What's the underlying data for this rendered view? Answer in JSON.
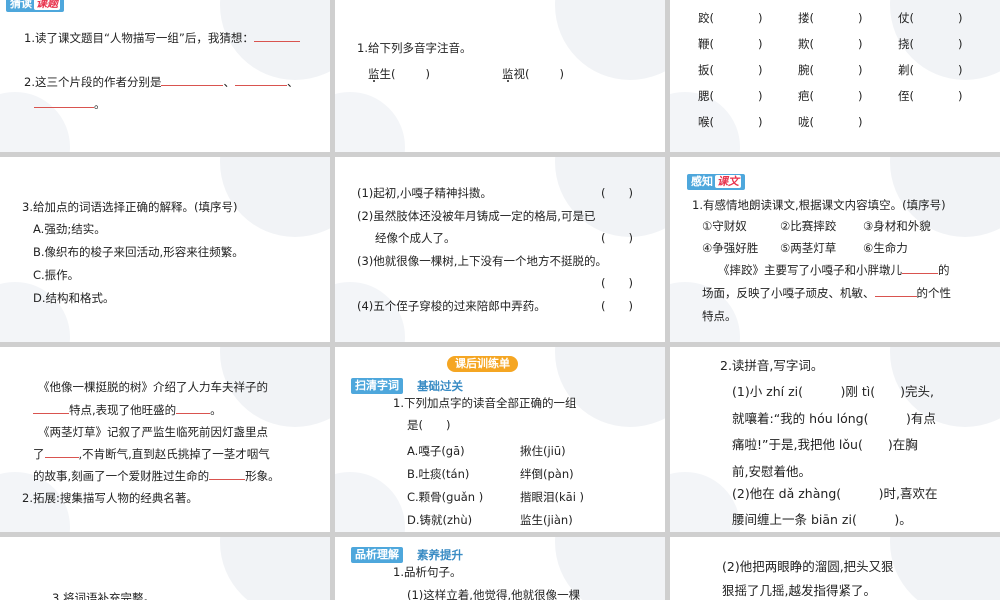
{
  "s1": {
    "tag_label": "猜读",
    "tag_highlight": "课题",
    "q1": "1.读了课文题目“人物描写一组”后，我猜想：",
    "q2_a": "2.这三个片段的作者分别是",
    "sep": "、",
    "end": "。"
  },
  "s2": {
    "q1": "1.给下列多音字注音。",
    "w1": "监生(",
    "w2": "监视(",
    "close": ")"
  },
  "s3": {
    "rows": [
      [
        "跤(",
        "搂(",
        "仗("
      ],
      [
        "鞭(",
        "欺(",
        "挠("
      ],
      [
        "扳(",
        "腕(",
        "剃("
      ],
      [
        "腮(",
        "疤(",
        "侄("
      ],
      [
        "喉(",
        "咙(",
        ""
      ]
    ],
    "close": ")"
  },
  "s4": {
    "q": "3.给加点的词语选择正确的解释。(填序号)",
    "opts": [
      "A.强劲;结实。",
      "B.像织布的梭子来回活动,形容来往频繁。",
      "C.振作。",
      "D.结构和格式。"
    ]
  },
  "s5": {
    "l1": "(1)起初,小嘎子精神抖擞。",
    "l2": "(2)虽然肢体还没被年月铸成一定的格局,可是已",
    "l3": "经像个成人了。",
    "l4": "(3)他就很像一棵树,上下没有一个地方不挺脱的。",
    "l5": "(4)五个侄子穿梭的过来陪郎中弄药。",
    "paren": "(　　)"
  },
  "s6": {
    "tag_label": "感知",
    "tag_highlight": "课文",
    "q": "1.有感情地朗读课文,根据课文内容填空。(填序号)",
    "opts": [
      "①守财奴",
      "②比赛摔跤",
      "③身材和外貌",
      "④争强好胜",
      "⑤两茎灯草",
      "⑥生命力"
    ],
    "p1": "《摔跤》主要写了小嘎子和小胖墩儿",
    "p1b": "的",
    "p2": "场面，反映了小嘎子顽皮、机敏、",
    "p2b": "的个性",
    "p3": "特点。"
  },
  "s7": {
    "l1": "《他像一棵挺脱的树》介绍了人力车夫祥子的",
    "l2": "特点,表现了他旺盛的",
    "l2b": "。",
    "l3": "《两茎灯草》记叙了严监生临死前因灯盏里点",
    "l4a": "了",
    "l4b": ",不肯断气,直到赵氏挑掉了一茎才咽气",
    "l5a": "的故事,刻画了一个爱财胜过生命的",
    "l5b": "形象。",
    "l6": "2.拓展:搜集描写人物的经典名著。"
  },
  "s8": {
    "pill": "课后训练单",
    "tag_label": "扫清字词",
    "tag_text": "基础过关",
    "q1": "1.下列加点字的读音全部正确的一组",
    "q2": "是(　　)",
    "opts": [
      [
        "A.嘎子(gā)",
        "揪住(jiū)"
      ],
      [
        "B.吐痰(tán)",
        "绊倒(pàn)"
      ],
      [
        "C.颗骨(guǎn )",
        "揩眼泪(kāi )"
      ],
      [
        "D.铸就(zhù)",
        "监生(jiàn)"
      ]
    ]
  },
  "s9": {
    "q": "2.读拼音,写字词。",
    "l1": "(1)小 zhí zi(　　　)刚 tì(　　)完头,",
    "l2": "就嚷着:“我的 hóu lóng(　　　)有点",
    "l3": "痛啦!”于是,我把他 lǒu(　　)在胸",
    "l4": "前,安慰着他。",
    "l5": "(2)他在 dǎ zhàng(　　　)时,喜欢在",
    "l6": "腰间缠上一条 biān zi(　　　)。"
  },
  "s10": {
    "q": "3.将词语补充完整。"
  },
  "s11": {
    "tag_label": "品析理解",
    "tag_text": "素养提升",
    "q": "1.品析句子。",
    "l1": "(1)这样立着,他觉得,他就很像一棵"
  },
  "s12": {
    "l1": "(2)他把两眼睁的溜圆,把头又狠",
    "l2": "狠摇了几摇,越发指得紧了。"
  }
}
